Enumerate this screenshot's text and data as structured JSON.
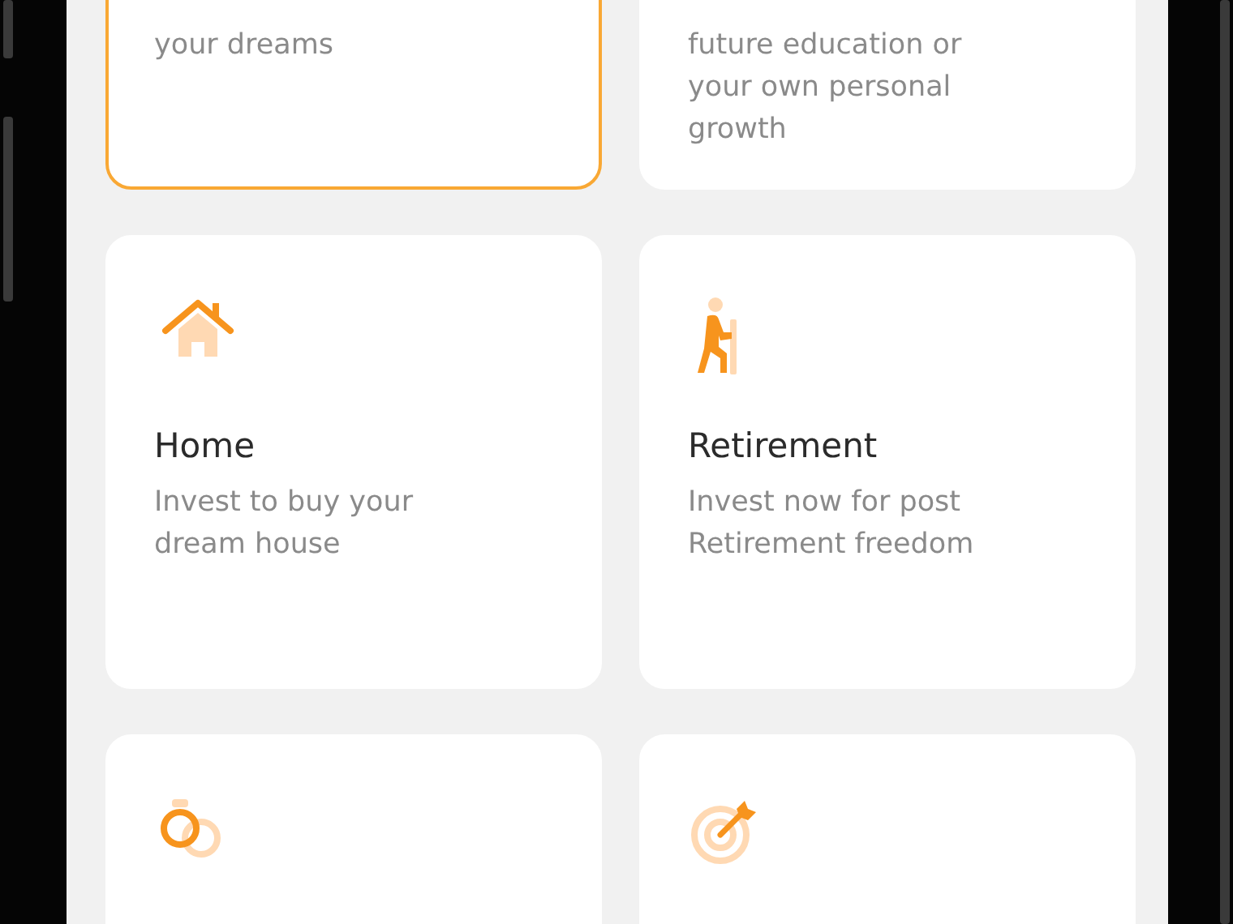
{
  "cards": [
    {
      "selected": true,
      "description_lines": [
        "your dreams"
      ]
    },
    {
      "selected": false,
      "description_lines": [
        "future education or",
        "your own personal",
        "growth"
      ]
    },
    {
      "selected": false,
      "kind": "house",
      "title": "Home",
      "description_lines": [
        "Invest to buy your",
        "dream house"
      ]
    },
    {
      "selected": false,
      "kind": "walker",
      "title": "Retirement",
      "description_lines": [
        "Invest now for post",
        "Retirement freedom"
      ]
    },
    {
      "selected": false,
      "kind": "rings"
    },
    {
      "selected": false,
      "kind": "target"
    }
  ]
}
